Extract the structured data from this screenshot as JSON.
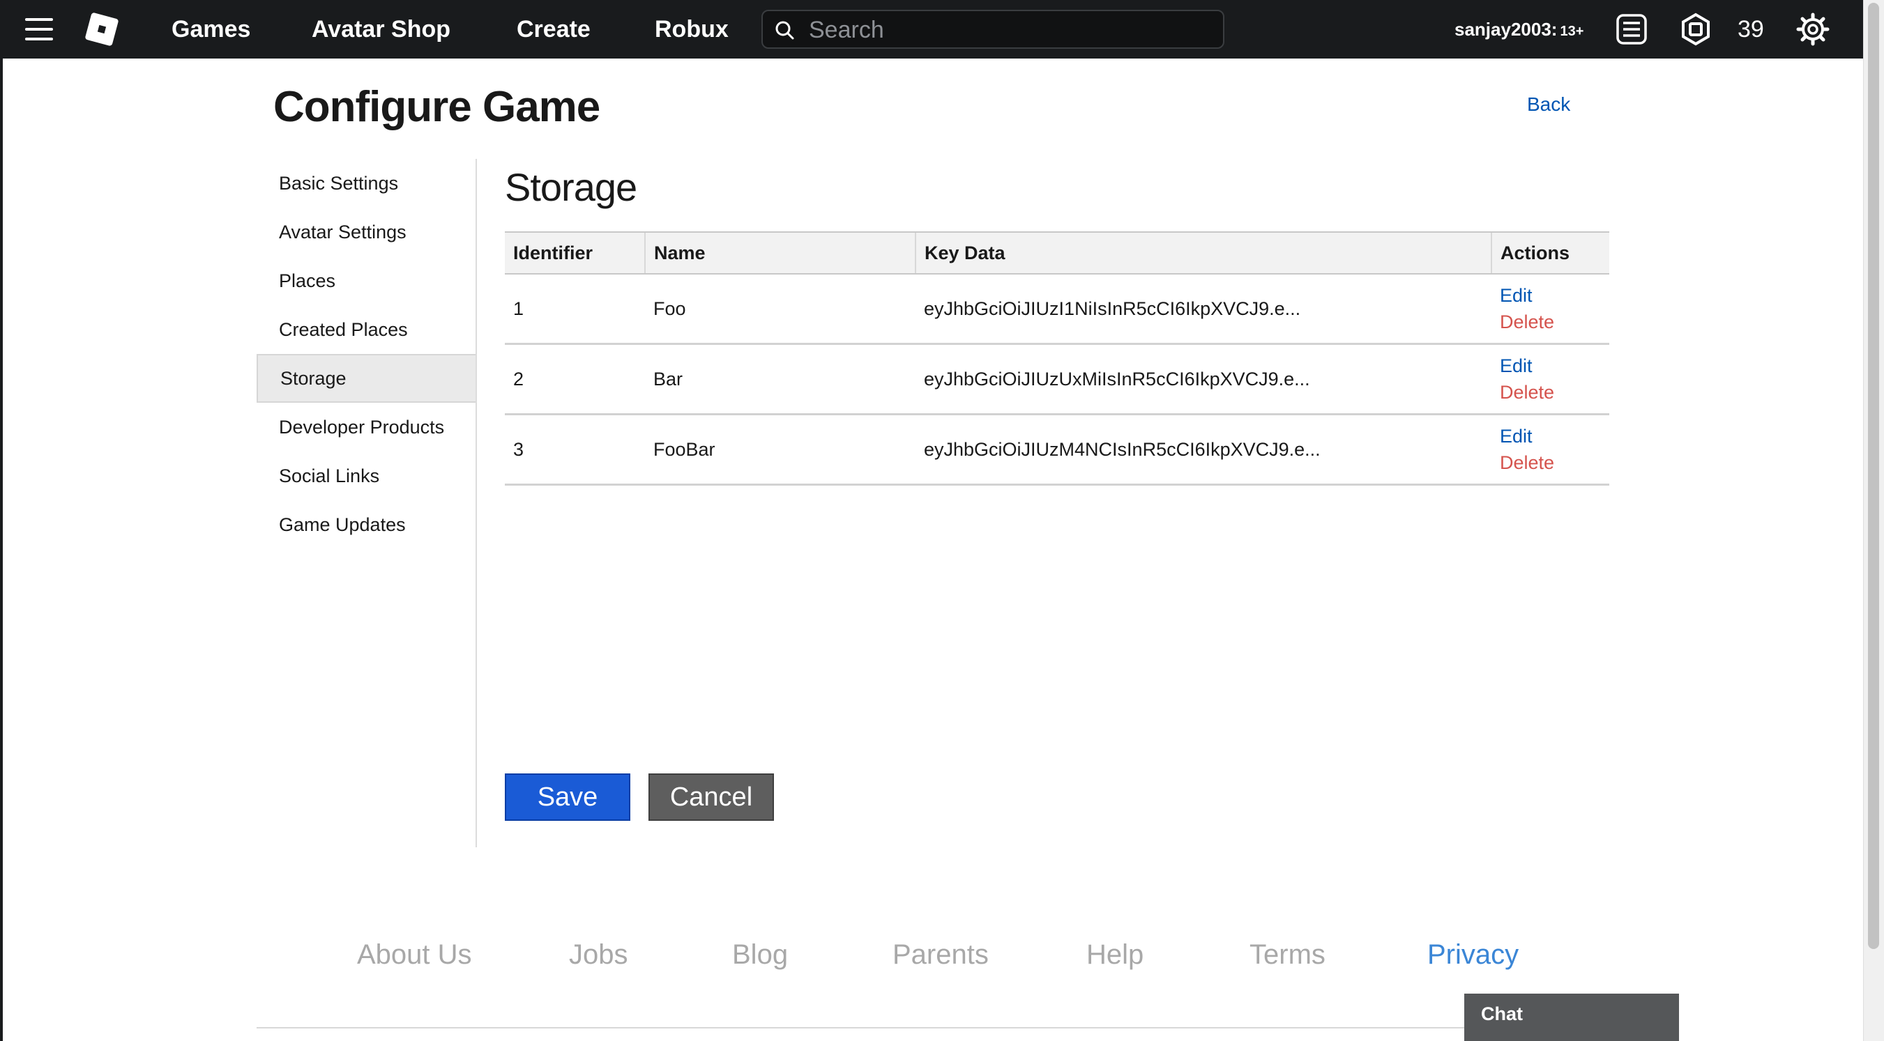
{
  "topbar": {
    "nav": [
      "Games",
      "Avatar Shop",
      "Create",
      "Robux"
    ],
    "search_placeholder": "Search",
    "username": "sanjay2003:",
    "age_badge": "13+",
    "robux_count": "39",
    "icons": [
      "menu-icon",
      "roblox-logo",
      "search-icon",
      "notifications-icon",
      "robux-icon",
      "settings-gear-icon"
    ]
  },
  "page": {
    "title": "Configure Game",
    "back_label": "Back"
  },
  "sidebar": {
    "items": [
      {
        "label": "Basic Settings",
        "active": false
      },
      {
        "label": "Avatar Settings",
        "active": false
      },
      {
        "label": "Places",
        "active": false
      },
      {
        "label": "Created Places",
        "active": false
      },
      {
        "label": "Storage",
        "active": true
      },
      {
        "label": "Developer Products",
        "active": false
      },
      {
        "label": "Social Links",
        "active": false
      },
      {
        "label": "Game Updates",
        "active": false
      }
    ]
  },
  "storage": {
    "title": "Storage",
    "columns": [
      "Identifier",
      "Name",
      "Key Data",
      "Actions"
    ],
    "rows": [
      {
        "id": "1",
        "name": "Foo",
        "key": "eyJhbGciOiJIUzI1NiIsInR5cCI6IkpXVCJ9.e...",
        "edit": "Edit",
        "delete": "Delete"
      },
      {
        "id": "2",
        "name": "Bar",
        "key": "eyJhbGciOiJIUzUxMiIsInR5cCI6IkpXVCJ9.e...",
        "edit": "Edit",
        "delete": "Delete"
      },
      {
        "id": "3",
        "name": "FooBar",
        "key": "eyJhbGciOiJIUzM4NCIsInR5cCI6IkpXVCJ9.e...",
        "edit": "Edit",
        "delete": "Delete"
      }
    ]
  },
  "buttons": {
    "save": "Save",
    "cancel": "Cancel"
  },
  "footer": {
    "links": [
      "About Us",
      "Jobs",
      "Blog",
      "Parents",
      "Help",
      "Terms",
      "Privacy"
    ]
  },
  "chat": {
    "label": "Chat"
  },
  "colors": {
    "topbar": "#191b1d",
    "link_blue": "#0055b3",
    "delete_red": "#d5534d",
    "save_blue": "#1a5bd6",
    "cancel_gray": "#5e5e5e",
    "privacy_blue": "#3b86d6"
  }
}
